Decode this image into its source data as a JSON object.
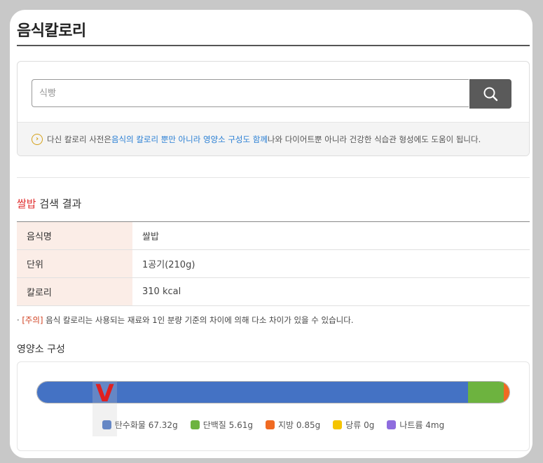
{
  "header": {
    "title": "음식칼로리"
  },
  "search": {
    "placeholder": "식빵",
    "value": ""
  },
  "info": {
    "prefix": "다신 칼로리 사전은 ",
    "link": "음식의 칼로리 뿐만 아니라 영양소 구성도 함께",
    "suffix": " 나와 다이어트뿐 아니라 건강한 식습관 형성에도 도움이 됩니다."
  },
  "results": {
    "query": "쌀밥",
    "heading_suffix": " 검색 결과",
    "rows": [
      {
        "label": "음식명",
        "value": "쌀밥"
      },
      {
        "label": "단위",
        "value": "1공기(210g)"
      },
      {
        "label": "칼로리",
        "value": "310 kcal"
      }
    ]
  },
  "notice": {
    "bullet": "· ",
    "tag": "[주의]",
    "text": " 음식 칼로리는 사용되는 재료와 1인 분량 기준의 차이에 의해 다소 차이가 있을 수 있습니다."
  },
  "nutrition": {
    "heading": "영양소 구성",
    "segments": [
      {
        "name": "탄수화물",
        "grams": 67.32,
        "color": "#4472c4"
      },
      {
        "name": "단백질",
        "grams": 5.61,
        "color": "#6db33f"
      },
      {
        "name": "지방",
        "grams": 0.85,
        "color": "#f06a22"
      },
      {
        "name": "당류",
        "grams": 0,
        "color": "#f5c400"
      },
      {
        "name": "나트륨",
        "grams": 0.004,
        "color": "#8e6cde"
      }
    ],
    "legend": [
      {
        "label": "탄수화물 67.32g",
        "color": "#4472c4"
      },
      {
        "label": "단백질 5.61g",
        "color": "#6db33f"
      },
      {
        "label": "지방 0.85g",
        "color": "#f06a22"
      },
      {
        "label": "당류 0g",
        "color": "#f5c400"
      },
      {
        "label": "나트륨 4mg",
        "color": "#8e6cde"
      }
    ]
  },
  "marker": {
    "text": "V",
    "color": "#e02020"
  }
}
